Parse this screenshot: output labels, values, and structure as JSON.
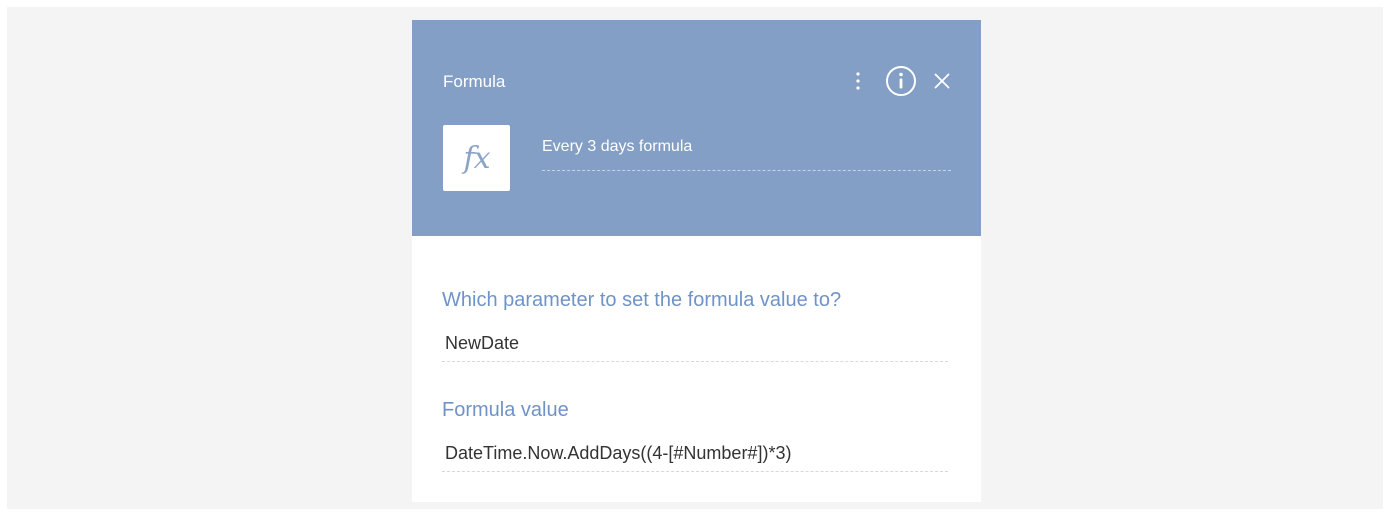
{
  "panel": {
    "title": "Formula",
    "element_name": "Every 3 days formula",
    "element_icon": "fx-icon",
    "icon_glyph": "fx",
    "header_color": "#849fc5",
    "label_color": "#6f93c8"
  },
  "header_actions": {
    "menu_icon": "more-vertical-icon",
    "info_icon": "info-icon",
    "close_icon": "close-icon"
  },
  "fields": [
    {
      "label": "Which parameter to set the formula value to?",
      "value": "NewDate"
    },
    {
      "label": "Formula value",
      "value": "DateTime.Now.AddDays((4-[#Number#])*3)"
    }
  ]
}
